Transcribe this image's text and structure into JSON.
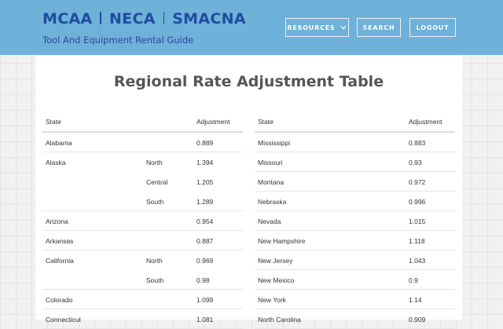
{
  "header": {
    "brand_parts": [
      "MCAA",
      "NECA",
      "SMACNA"
    ],
    "subtitle": "Tool And Equipment Rental Guide",
    "nav": {
      "resources": "RESOURCES",
      "search": "SEARCH",
      "logout": "LOGOUT"
    }
  },
  "page": {
    "title": "Regional Rate Adjustment Table"
  },
  "left_table": {
    "columns": {
      "state": "State",
      "adjustment": "Adjustment"
    },
    "rows": [
      {
        "state": "Alabama",
        "region": "",
        "adjustment": "0.889"
      },
      {
        "state": "Alaska",
        "region": "North",
        "adjustment": "1.394"
      },
      {
        "state": "",
        "region": "Central",
        "adjustment": "1.205"
      },
      {
        "state": "",
        "region": "South",
        "adjustment": "1.289"
      },
      {
        "state": "Arizona",
        "region": "",
        "adjustment": "0.954"
      },
      {
        "state": "Arkansas",
        "region": "",
        "adjustment": "0.887"
      },
      {
        "state": "California",
        "region": "North",
        "adjustment": "0.969"
      },
      {
        "state": "",
        "region": "South",
        "adjustment": "0.98"
      },
      {
        "state": "Colorado",
        "region": "",
        "adjustment": "1.099"
      },
      {
        "state": "Connecticut",
        "region": "",
        "adjustment": "1.081"
      }
    ]
  },
  "right_table": {
    "columns": {
      "state": "State",
      "adjustment": "Adjustment"
    },
    "rows": [
      {
        "state": "Mississippi",
        "adjustment": "0.883"
      },
      {
        "state": "Missouri",
        "adjustment": "0.93"
      },
      {
        "state": "Montana",
        "adjustment": "0.972"
      },
      {
        "state": "Nebraska",
        "adjustment": "0.996"
      },
      {
        "state": "Nevada",
        "adjustment": "1.015"
      },
      {
        "state": "New Hampshire",
        "adjustment": "1.118"
      },
      {
        "state": "New Jersey",
        "adjustment": "1.043"
      },
      {
        "state": "New Mexico",
        "adjustment": "0.9"
      },
      {
        "state": "New York",
        "adjustment": "1.14"
      },
      {
        "state": "North Carolina",
        "adjustment": "0.909"
      }
    ]
  }
}
